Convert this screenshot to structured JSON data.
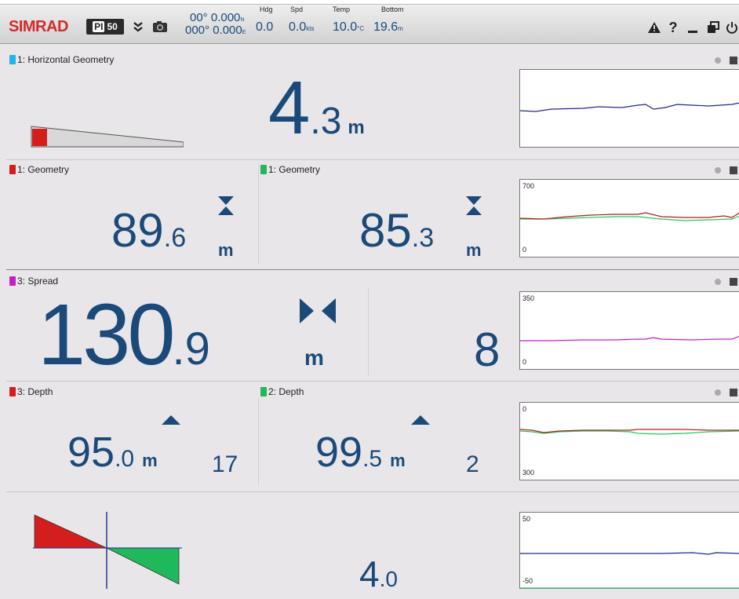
{
  "brand": {
    "logo": "SIMRAD",
    "model_pi": "PI",
    "model_num": "50"
  },
  "nav": {
    "lat": "00° 0.000",
    "lat_dir": "N",
    "lon": "000° 0.000",
    "lon_dir": "E",
    "hdg_label": "Hdg",
    "hdg": "0.0",
    "spd_label": "Spd",
    "spd": "0.0",
    "spd_unit": "kts",
    "temp_label": "Temp",
    "temp": "10.0",
    "temp_unit": "°C",
    "bottom_label": "Bottom",
    "bottom": "19.6",
    "bottom_unit": "m"
  },
  "toolbar_icons": [
    "double-chevron-down-icon",
    "camera-icon",
    "warning-icon",
    "help-icon",
    "minimize-icon",
    "restore-icon",
    "power-icon"
  ],
  "panels": {
    "horizontal": {
      "title": "1: Horizontal Geometry",
      "color": "#22b4e8",
      "int": "4",
      "dec": ".3",
      "unit": "m"
    },
    "geom1": {
      "title": "1: Geometry",
      "color": "#d41e1e",
      "int": "89",
      "dec": ".6",
      "unit": "m"
    },
    "geom2": {
      "title": "1: Geometry",
      "color": "#1fb85a",
      "int": "85",
      "dec": ".3",
      "unit": "m",
      "chart_top": "700",
      "chart_bottom": "0"
    },
    "spread": {
      "title": "3: Spread",
      "color": "#c81ec8",
      "int": "130",
      "dec": ".9",
      "unit": "m",
      "count": "8",
      "chart_top": "350",
      "chart_bottom": "0"
    },
    "depth1": {
      "title": "3: Depth",
      "color": "#d41e1e",
      "int": "95",
      "dec": ".0",
      "unit": "m",
      "count": "17"
    },
    "depth2": {
      "title": "2: Depth",
      "color": "#1fb85a",
      "int": "99",
      "dec": ".5",
      "unit": "m",
      "count": "2",
      "chart_top": "0",
      "chart_bottom": "300"
    },
    "roll": {
      "int": "4",
      "dec": ".0",
      "chart_top": "50",
      "chart_bottom": "-50"
    }
  },
  "colors": {
    "value_blue": "#1b4a7a",
    "line_blue": "#1a2a8a",
    "line_red": "#b81c1c",
    "line_green": "#22c85a",
    "line_magenta": "#c020c0"
  }
}
